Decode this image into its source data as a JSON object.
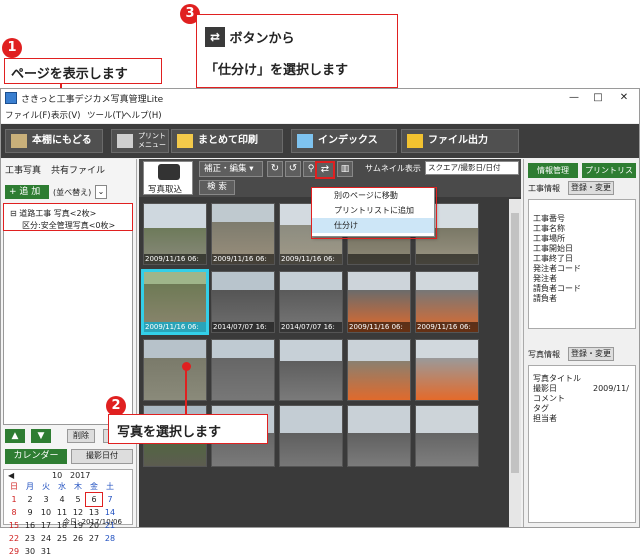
{
  "callouts": {
    "c1": {
      "num": "1",
      "text": "ページを表示します"
    },
    "c2": {
      "num": "2",
      "text": "写真を選択します"
    },
    "c3": {
      "num": "3",
      "line1": "ボタンから",
      "line2": "「仕分け」を選択します"
    }
  },
  "window": {
    "title": "さきっと工事デジカメ写真管理Lite",
    "controls": {
      "minimize": "—",
      "maximize": "□",
      "close": "✕"
    }
  },
  "menubar": [
    "ファイル(F)",
    "表示(V)",
    "ツール(T)",
    "ヘルプ(H)"
  ],
  "toolbar": {
    "home": "本棚にもどる",
    "print_menu": "プリント\nメニュー",
    "batch_print": "まとめて印刷",
    "index": "インデックス",
    "file_output": "ファイル出力"
  },
  "left": {
    "tabs": [
      "工事写真",
      "共有ファイル"
    ],
    "add": "追 加",
    "sort": "(並べ替え)",
    "tree": [
      "道路工事 写真<2枚>",
      "区分:安全管理写真<0枚>"
    ],
    "buttons": {
      "delete": "削除",
      "settings": "設定"
    },
    "calendar_tab": "カレンダー",
    "date_tab": "撮影日付",
    "calendar": {
      "month": "10",
      "year": "2017",
      "weekdays": [
        "日",
        "月",
        "火",
        "水",
        "木",
        "金",
        "土"
      ],
      "weeks": [
        [
          "1",
          "2",
          "3",
          "4",
          "5",
          "6",
          "7"
        ],
        [
          "8",
          "9",
          "10",
          "11",
          "12",
          "13",
          "14"
        ],
        [
          "15",
          "16",
          "17",
          "18",
          "19",
          "20",
          "21"
        ],
        [
          "22",
          "23",
          "24",
          "25",
          "26",
          "27",
          "28"
        ],
        [
          "29",
          "30",
          "31",
          "",
          "",
          "",
          ""
        ]
      ],
      "today": "今日: 2017/10/06"
    }
  },
  "center": {
    "import": "写真取込",
    "edit": "補正・編集",
    "search": "検 索",
    "thumb_label": "サムネイル表示",
    "thumb_option": "スクエア/撮影日/日付",
    "menu": [
      "別のページに移動",
      "プリントリストに追加",
      "仕分け"
    ],
    "thumbs_row1": [
      "2009/11/16 06:",
      "2009/11/16 06:",
      "2009/11/16 06:",
      "",
      ""
    ],
    "thumbs_row2": [
      "2009/11/16 06:",
      "2014/07/07 16:",
      "2014/07/07 16:",
      "2009/11/16 06:",
      "2009/11/16 06:"
    ]
  },
  "right": {
    "tabs": [
      "情報管理",
      "プリントリスト"
    ],
    "work_info": "工事情報",
    "register": "登録・変更",
    "work_fields": [
      "工事番号",
      "工事名称",
      "工事場所",
      "工事開始日",
      "工事終了日",
      "発注者コード",
      "発注者",
      "請負者コード",
      "請負者"
    ],
    "photo_info": "写真情報",
    "photo_register": "登録・変更",
    "photo_fields": [
      "写真タイトル",
      "撮影日",
      "コメント",
      "タグ",
      "担当者"
    ],
    "photo_date": "2009/11/"
  }
}
